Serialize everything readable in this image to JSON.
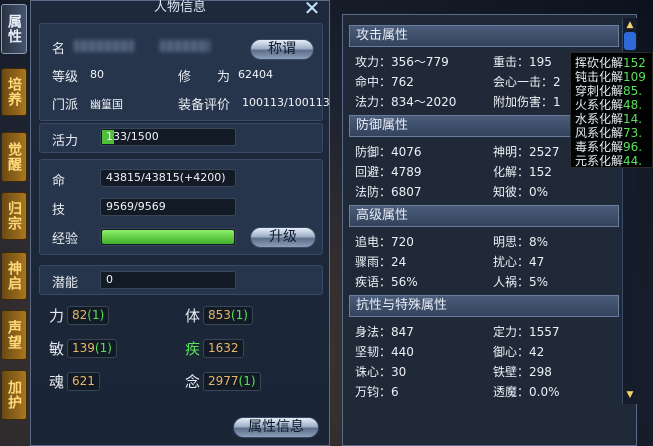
{
  "left_tabs": [
    {
      "label": "属性",
      "active": true
    },
    {
      "label": "培养",
      "active": false
    },
    {
      "label": "觉醒",
      "active": false
    },
    {
      "label": "归宗",
      "active": false
    },
    {
      "label": "神启",
      "active": false
    },
    {
      "label": "声望",
      "active": false
    },
    {
      "label": "加护",
      "active": false
    }
  ],
  "panel": {
    "title": "人物信息",
    "name_label": "名",
    "title_button": "称谓",
    "level_label": "等级",
    "level_value": "80",
    "cultivation_label": "修　　为",
    "cultivation_value": "62404",
    "sect_label": "门派",
    "sect_value": "幽篁国",
    "equip_label": "装备评价",
    "equip_value": "100113/100113",
    "vigor_label": "活力",
    "vigor_value": "133/1500",
    "vigor_fill_fraction": 0.09,
    "hp_label": "命",
    "hp_value": "43815/43815(+4200)",
    "skill_label": "技",
    "skill_value": "9569/9569",
    "exp_label": "经验",
    "exp_fill_fraction": 1.0,
    "upgrade_button": "升级",
    "potential_label": "潜能",
    "potential_value": "0",
    "attr_info_button": "属性信息",
    "stats": [
      {
        "label": "力",
        "value": "82",
        "bonus": "(1)",
        "label_color": "#e8ecf2"
      },
      {
        "label": "体",
        "value": "853",
        "bonus": "(1)",
        "label_color": "#e8ecf2"
      },
      {
        "label": "敏",
        "value": "139",
        "bonus": "(1)",
        "label_color": "#e8ecf2"
      },
      {
        "label": "疾",
        "value": "1632",
        "bonus": "",
        "label_color": "#59e05a"
      },
      {
        "label": "魂",
        "value": "621",
        "bonus": "",
        "label_color": "#e8ecf2"
      },
      {
        "label": "念",
        "value": "2977",
        "bonus": "(1)",
        "label_color": "#e8ecf2"
      }
    ]
  },
  "right": {
    "sections": [
      {
        "title": "攻击属性",
        "rows": [
          [
            "攻力：356～779",
            "重击：195"
          ],
          [
            "命中：762",
            "会心一击：2"
          ],
          [
            "法力：834～2020",
            "附加伤害：1"
          ]
        ]
      },
      {
        "title": "防御属性",
        "rows": [
          [
            "防御：4076",
            "神明：2527"
          ],
          [
            "回避：4789",
            "化解：152"
          ],
          [
            "法防：6807",
            "知彼：0%"
          ]
        ]
      },
      {
        "title": "高级属性",
        "rows": [
          [
            "追电：720",
            "明思：8%"
          ],
          [
            "骤雨：24",
            "扰心：47"
          ],
          [
            "疾语：56%",
            "人祸：5%"
          ]
        ]
      },
      {
        "title": "抗性与特殊属性",
        "rows": [
          [
            "身法：847",
            "定力：1557"
          ],
          [
            "坚韧：440",
            "御心：42"
          ],
          [
            "诛心：30",
            "铁壁：298"
          ],
          [
            "万钧：6",
            "透魔：0.0%"
          ]
        ]
      }
    ]
  },
  "tooltip": {
    "rows": [
      {
        "label": "挥砍化解",
        "value": "152"
      },
      {
        "label": "钝击化解",
        "value": "109"
      },
      {
        "label": "穿刺化解",
        "value": "85."
      },
      {
        "label": "火系化解",
        "value": "48."
      },
      {
        "label": "水系化解",
        "value": "14."
      },
      {
        "label": "风系化解",
        "value": "73."
      },
      {
        "label": "毒系化解",
        "value": "96."
      },
      {
        "label": "元系化解",
        "value": "44."
      }
    ]
  },
  "colors": {
    "accent_green": "#59e05a",
    "tab_gold": "#a8761f",
    "panel_bg": "#1e2a3c"
  }
}
